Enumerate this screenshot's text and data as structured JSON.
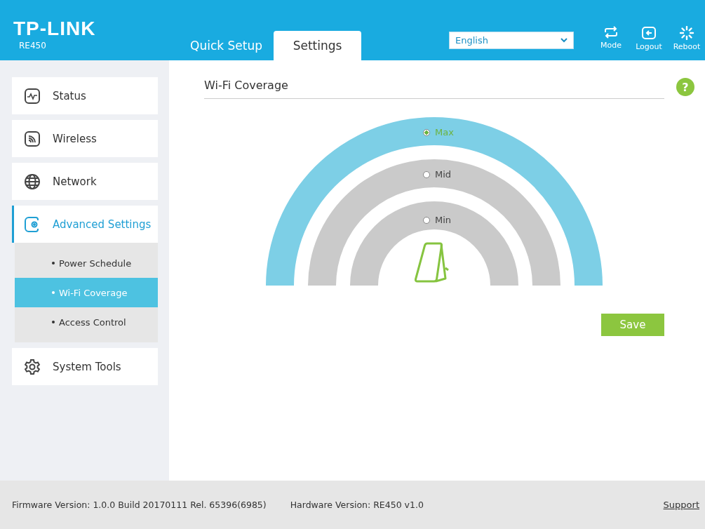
{
  "header": {
    "logo": "TP-LINK",
    "model": "RE450",
    "tabs": [
      {
        "label": "Quick Setup",
        "selected": false
      },
      {
        "label": "Settings",
        "selected": true
      }
    ],
    "language": {
      "value": "English"
    },
    "actions": [
      {
        "kind": "mode",
        "label": "Mode"
      },
      {
        "kind": "logout",
        "label": "Logout"
      },
      {
        "kind": "reboot",
        "label": "Reboot"
      }
    ]
  },
  "sidebar": {
    "items": [
      {
        "label": "Status",
        "selected": false
      },
      {
        "label": "Wireless",
        "selected": false
      },
      {
        "label": "Network",
        "selected": false
      },
      {
        "label": "Advanced Settings",
        "selected": true,
        "children": [
          {
            "label": "Power Schedule",
            "selected": false
          },
          {
            "label": "Wi-Fi Coverage",
            "selected": true
          },
          {
            "label": "Access Control",
            "selected": false
          }
        ]
      },
      {
        "label": "System Tools",
        "selected": false
      }
    ]
  },
  "main": {
    "title": "Wi-Fi Coverage",
    "help": "?",
    "coverage_options": [
      {
        "label": "Max",
        "selected": true
      },
      {
        "label": "Mid",
        "selected": false
      },
      {
        "label": "Min",
        "selected": false
      }
    ],
    "save_button": "Save"
  },
  "footer": {
    "firmware": "Firmware Version: 1.0.0 Build 20170111 Rel. 65396(6985)",
    "hardware": "Hardware Version: RE450 v1.0",
    "support": "Support"
  }
}
